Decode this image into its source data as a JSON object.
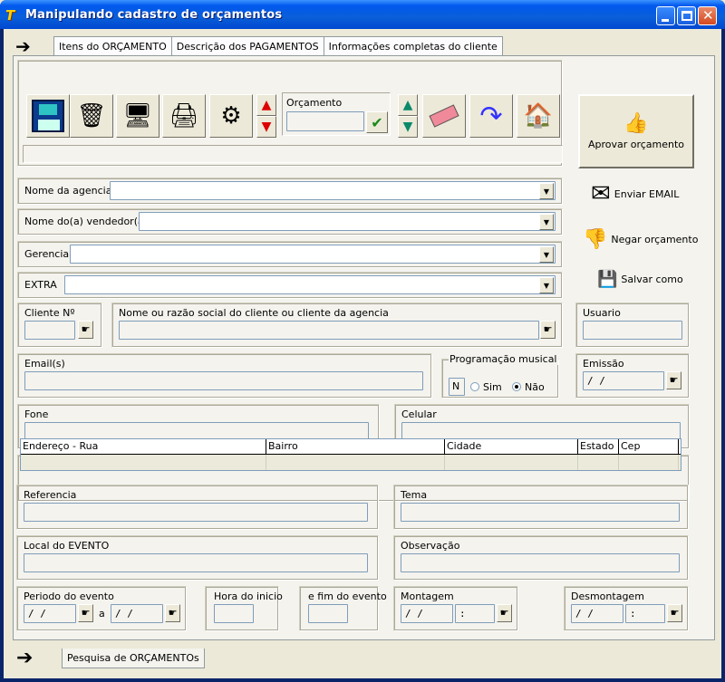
{
  "window": {
    "title": "Manipulando cadastro de orçamentos",
    "app_icon": "T"
  },
  "tabs": [
    "Itens do ORÇAMENTO",
    "Descrição dos PAGAMENTOS",
    "Informações completas do cliente"
  ],
  "toolbar": {
    "orcamento_label": "Orçamento",
    "orcamento_value": ""
  },
  "actions": {
    "aprovar": "Aprovar orçamento",
    "enviar_email": "Enviar EMAIL",
    "negar": "Negar orçamento",
    "salvar_como": "Salvar como"
  },
  "form": {
    "agencia_label": "Nome da agencia",
    "vendedor_label": "Nome do(a) vendedor(a)",
    "gerencia_label": "Gerencia",
    "extra_label": "EXTRA",
    "cliente_no_label": "Cliente Nº",
    "cliente_nome_label": "Nome ou razão social do cliente ou cliente da agencia",
    "usuario_label": "Usuario",
    "email_label": "Email(s)",
    "programacao_label": "Programação musical",
    "programacao_value": "N",
    "sim_label": "Sim",
    "nao_label": "Não",
    "emissao_label": "Emissão",
    "emissao_value": "/ /",
    "fone_label": "Fone",
    "celular_label": "Celular",
    "referencia_label": "Referencia",
    "tema_label": "Tema",
    "local_label": "Local do EVENTO",
    "observacao_label": "Observação",
    "periodo_label": "Periodo do evento",
    "periodo_ini": "/ /",
    "periodo_a": "a",
    "periodo_fim": "/ /",
    "hora_inicio_label": "Hora do inicio",
    "fim_evento_label": "e fim do evento",
    "montagem_label": "Montagem",
    "montagem_date": "/ /",
    "montagem_time": ":",
    "desmontagem_label": "Desmontagem",
    "desmontagem_date": "/ /",
    "desmontagem_time": ":"
  },
  "address_grid": {
    "columns": [
      "Endereço - Rua",
      "Bairro",
      "Cidade",
      "Estado",
      "Cep"
    ]
  },
  "bottom_tab": "Pesquisa de ORÇAMENTOs"
}
